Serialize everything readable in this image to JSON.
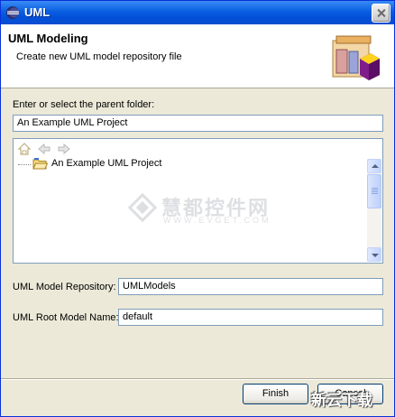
{
  "window": {
    "title": "UML"
  },
  "banner": {
    "title": "UML Modeling",
    "description": "Create new UML model repository file"
  },
  "parent_folder": {
    "label": "Enter or select the parent folder:",
    "value": "An Example UML Project"
  },
  "tree": {
    "toolbar": [
      "home-icon",
      "back-arrow-icon",
      "forward-arrow-icon"
    ],
    "items": [
      {
        "label": "An Example UML Project",
        "icon": "project-folder-icon"
      }
    ]
  },
  "repository": {
    "label": "UML Model Repository:",
    "value": "UMLModels"
  },
  "root_model": {
    "label": "UML Root Model Name:",
    "value": "default"
  },
  "buttons": {
    "finish": "Finish",
    "cancel": "Cancel"
  },
  "watermark": {
    "text": "慧都控件网",
    "sub": "WWW.EVGET.COM"
  },
  "corner_watermark": "新云下载"
}
